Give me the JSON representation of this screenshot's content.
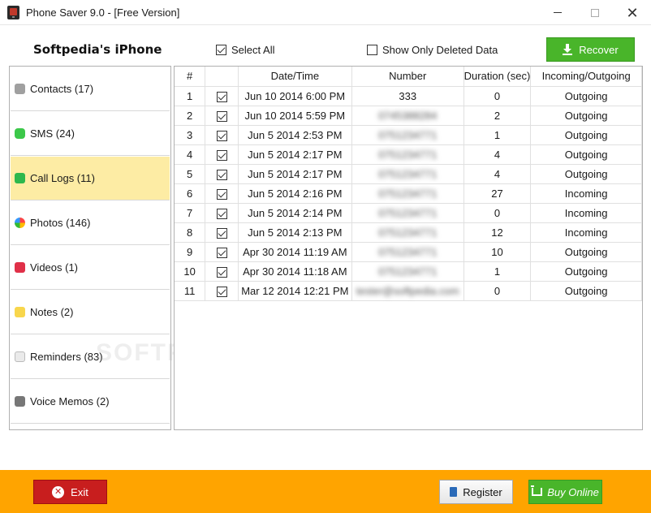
{
  "window": {
    "title": "Phone Saver 9.0 - [Free Version]"
  },
  "header": {
    "device_title": "Softpedia's iPhone",
    "select_all_label": "Select All",
    "select_all_checked": true,
    "show_deleted_label": "Show Only Deleted Data",
    "show_deleted_checked": false,
    "recover_label": "Recover"
  },
  "sidebar": {
    "items": [
      {
        "label": "Contacts (17)",
        "icon": "contacts-icon"
      },
      {
        "label": "SMS (24)",
        "icon": "sms-icon"
      },
      {
        "label": "Call Logs (11)",
        "icon": "call-icon",
        "active": true
      },
      {
        "label": "Photos (146)",
        "icon": "photos-icon"
      },
      {
        "label": "Videos (1)",
        "icon": "videos-icon"
      },
      {
        "label": "Notes (2)",
        "icon": "notes-icon"
      },
      {
        "label": "Reminders (83)",
        "icon": "reminders-icon"
      },
      {
        "label": "Voice Memos (2)",
        "icon": "voice-memos-icon"
      }
    ]
  },
  "table": {
    "columns": [
      "#",
      "",
      "Date/Time",
      "Number",
      "Duration (sec)",
      "Incoming/Outgoing"
    ],
    "rows": [
      {
        "n": "1",
        "checked": true,
        "datetime": "Jun 10 2014 6:00 PM",
        "number": "333",
        "number_blurred": false,
        "duration": "0",
        "direction": "Outgoing"
      },
      {
        "n": "2",
        "checked": true,
        "datetime": "Jun 10 2014 5:59 PM",
        "number": "0745388284",
        "number_blurred": true,
        "duration": "2",
        "direction": "Outgoing"
      },
      {
        "n": "3",
        "checked": true,
        "datetime": "Jun 5 2014 2:53 PM",
        "number": "0751234771",
        "number_blurred": true,
        "duration": "1",
        "direction": "Outgoing"
      },
      {
        "n": "4",
        "checked": true,
        "datetime": "Jun 5 2014 2:17 PM",
        "number": "0751234771",
        "number_blurred": true,
        "duration": "4",
        "direction": "Outgoing"
      },
      {
        "n": "5",
        "checked": true,
        "datetime": "Jun 5 2014 2:17 PM",
        "number": "0751234771",
        "number_blurred": true,
        "duration": "4",
        "direction": "Outgoing"
      },
      {
        "n": "6",
        "checked": true,
        "datetime": "Jun 5 2014 2:16 PM",
        "number": "0751234771",
        "number_blurred": true,
        "duration": "27",
        "direction": "Incoming"
      },
      {
        "n": "7",
        "checked": true,
        "datetime": "Jun 5 2014 2:14 PM",
        "number": "0751234771",
        "number_blurred": true,
        "duration": "0",
        "direction": "Incoming"
      },
      {
        "n": "8",
        "checked": true,
        "datetime": "Jun 5 2014 2:13 PM",
        "number": "0751234771",
        "number_blurred": true,
        "duration": "12",
        "direction": "Incoming"
      },
      {
        "n": "9",
        "checked": true,
        "datetime": "Apr 30 2014 11:19 AM",
        "number": "0751234771",
        "number_blurred": true,
        "duration": "10",
        "direction": "Outgoing"
      },
      {
        "n": "10",
        "checked": true,
        "datetime": "Apr 30 2014 11:18 AM",
        "number": "0751234771",
        "number_blurred": true,
        "duration": "1",
        "direction": "Outgoing"
      },
      {
        "n": "11",
        "checked": true,
        "datetime": "Mar 12 2014 12:21 PM",
        "number": "tester@softpedia.com",
        "number_blurred": true,
        "duration": "0",
        "direction": "Outgoing"
      }
    ]
  },
  "footer": {
    "exit_label": "Exit",
    "register_label": "Register",
    "buy_label": "Buy Online"
  },
  "watermark": "SOFTPEDIA",
  "colors": {
    "accent_green": "#49b52a",
    "footer_orange": "#ffa400",
    "exit_red": "#c81e1e",
    "active_item": "#fdeca4"
  }
}
